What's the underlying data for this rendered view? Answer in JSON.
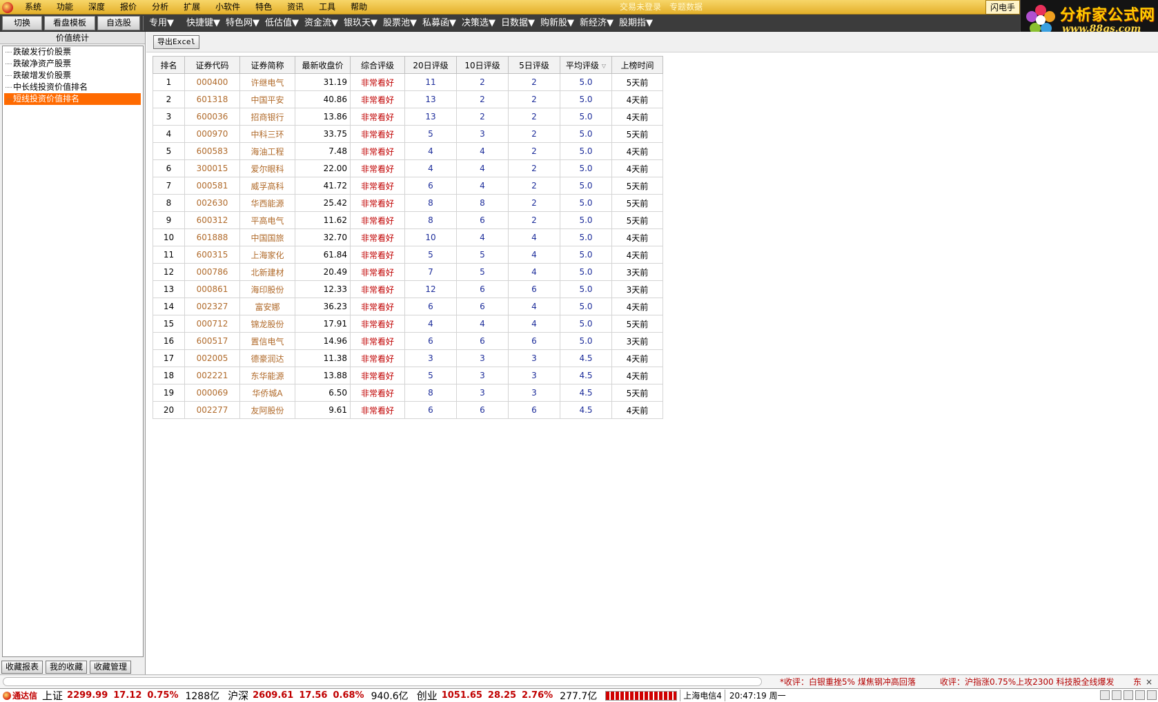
{
  "menubar": {
    "items": [
      "系统",
      "功能",
      "深度",
      "报价",
      "分析",
      "扩展",
      "小软件",
      "特色",
      "资讯",
      "工具",
      "帮助"
    ],
    "login_status": "交易未登录",
    "topic_data": "专题数据",
    "right_label": "闪电手"
  },
  "logo": {
    "title": "分析家公式网",
    "url": "www.88gs.com"
  },
  "toolbar": {
    "buttons": [
      "切换",
      "看盘模板",
      "自选股"
    ],
    "dropdowns": [
      "专用▼",
      "快捷键▼",
      "特色网▼",
      "低估值▼",
      "资金流▼",
      "银玖天▼",
      "股票池▼",
      "私募函▼",
      "决策选▼",
      "日数据▼",
      "购新股▼",
      "新经济▼",
      "股期指▼"
    ]
  },
  "sidebar": {
    "title": "价值统计",
    "items": [
      "跌破发行价股票",
      "跌破净资产股票",
      "跌破增发价股票",
      "中长线投资价值排名",
      "短线投资价值排名"
    ],
    "active_index": 4,
    "buttons": [
      "收藏报表",
      "我的收藏",
      "收藏管理"
    ]
  },
  "content": {
    "export_label": "导出Excel"
  },
  "table": {
    "columns": [
      "排名",
      "证券代码",
      "证券简称",
      "最新收盘价",
      "综合评级",
      "20日评级",
      "10日评级",
      "5日评级",
      "平均评级",
      "上榜时间"
    ],
    "rows": [
      [
        "1",
        "000400",
        "许继电气",
        "31.19",
        "非常看好",
        "11",
        "2",
        "2",
        "5.0",
        "5天前"
      ],
      [
        "2",
        "601318",
        "中国平安",
        "40.86",
        "非常看好",
        "13",
        "2",
        "2",
        "5.0",
        "4天前"
      ],
      [
        "3",
        "600036",
        "招商银行",
        "13.86",
        "非常看好",
        "13",
        "2",
        "2",
        "5.0",
        "4天前"
      ],
      [
        "4",
        "000970",
        "中科三环",
        "33.75",
        "非常看好",
        "5",
        "3",
        "2",
        "5.0",
        "5天前"
      ],
      [
        "5",
        "600583",
        "海油工程",
        "7.48",
        "非常看好",
        "4",
        "4",
        "2",
        "5.0",
        "4天前"
      ],
      [
        "6",
        "300015",
        "爱尔眼科",
        "22.00",
        "非常看好",
        "4",
        "4",
        "2",
        "5.0",
        "4天前"
      ],
      [
        "7",
        "000581",
        "威孚高科",
        "41.72",
        "非常看好",
        "6",
        "4",
        "2",
        "5.0",
        "5天前"
      ],
      [
        "8",
        "002630",
        "华西能源",
        "25.42",
        "非常看好",
        "8",
        "8",
        "2",
        "5.0",
        "5天前"
      ],
      [
        "9",
        "600312",
        "平高电气",
        "11.62",
        "非常看好",
        "8",
        "6",
        "2",
        "5.0",
        "5天前"
      ],
      [
        "10",
        "601888",
        "中国国旅",
        "32.70",
        "非常看好",
        "10",
        "4",
        "4",
        "5.0",
        "4天前"
      ],
      [
        "11",
        "600315",
        "上海家化",
        "61.84",
        "非常看好",
        "5",
        "5",
        "4",
        "5.0",
        "4天前"
      ],
      [
        "12",
        "000786",
        "北新建材",
        "20.49",
        "非常看好",
        "7",
        "5",
        "4",
        "5.0",
        "3天前"
      ],
      [
        "13",
        "000861",
        "海印股份",
        "12.33",
        "非常看好",
        "12",
        "6",
        "6",
        "5.0",
        "3天前"
      ],
      [
        "14",
        "002327",
        "富安娜",
        "36.23",
        "非常看好",
        "6",
        "6",
        "4",
        "5.0",
        "4天前"
      ],
      [
        "15",
        "000712",
        "锦龙股份",
        "17.91",
        "非常看好",
        "4",
        "4",
        "4",
        "5.0",
        "5天前"
      ],
      [
        "16",
        "600517",
        "置信电气",
        "14.96",
        "非常看好",
        "6",
        "6",
        "6",
        "5.0",
        "3天前"
      ],
      [
        "17",
        "002005",
        "德豪润达",
        "11.38",
        "非常看好",
        "3",
        "3",
        "3",
        "4.5",
        "4天前"
      ],
      [
        "18",
        "002221",
        "东华能源",
        "13.88",
        "非常看好",
        "5",
        "3",
        "3",
        "4.5",
        "4天前"
      ],
      [
        "19",
        "000069",
        "华侨城A",
        "6.50",
        "非常看好",
        "8",
        "3",
        "3",
        "4.5",
        "5天前"
      ],
      [
        "20",
        "002277",
        "友阿股份",
        "9.61",
        "非常看好",
        "6",
        "6",
        "6",
        "4.5",
        "4天前"
      ]
    ]
  },
  "news": {
    "item1": "*收评：白银重挫5% 煤焦钢冲高回落",
    "item2": "收评：沪指涨0.75%上攻2300 科技股全线爆发",
    "item3": "东",
    "close": "×"
  },
  "ticker": {
    "brand": "通达信",
    "sh_name": "上证",
    "sh_value": "2299.99",
    "sh_change": "17.12",
    "sh_pct": "0.75%",
    "sh_amount": "1288亿",
    "sz_name": "沪深",
    "sz_value": "2609.61",
    "sz_change": "17.56",
    "sz_pct": "0.68%",
    "sz_amount": "940.6亿",
    "cy_name": "创业",
    "cy_value": "1051.65",
    "cy_change": "28.25",
    "cy_pct": "2.76%",
    "cy_amount": "277.7亿",
    "isp": "上海电信4",
    "clock": "20:47:19 周一"
  },
  "colors": {
    "accent_orange": "#ff6a00",
    "rating_red": "#c00000",
    "code_brown": "#b06a2a",
    "num_blue": "#1c2c9a",
    "menubar_gold": "#e4b02a"
  }
}
